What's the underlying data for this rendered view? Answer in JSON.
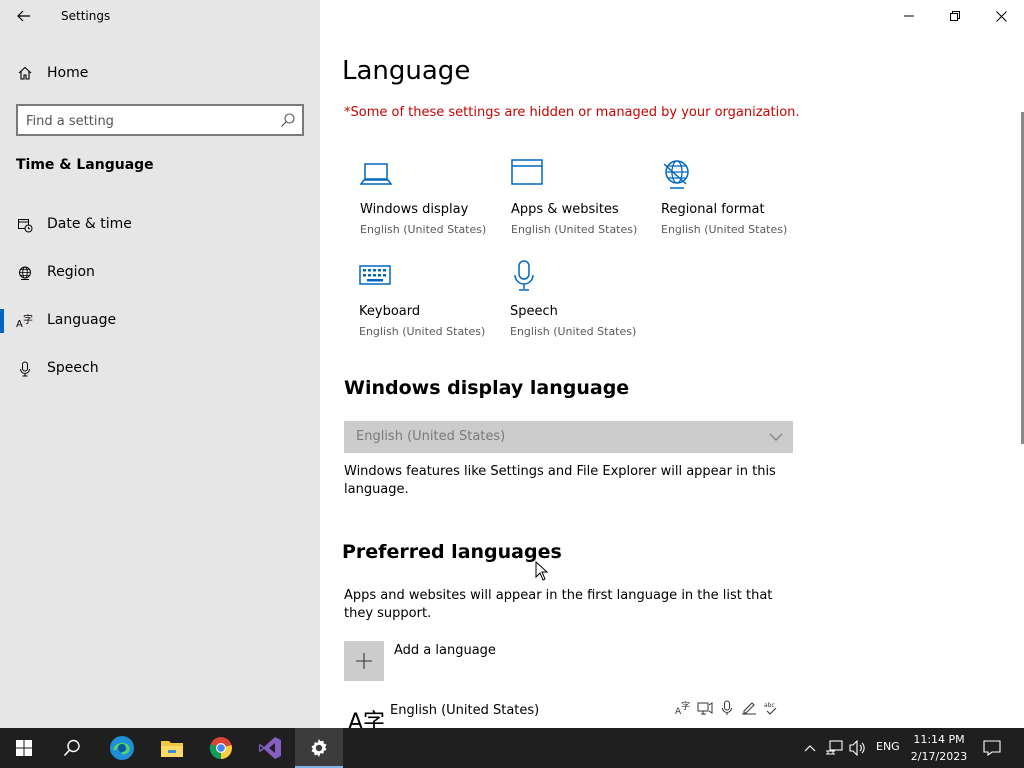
{
  "app": {
    "title": "Settings"
  },
  "sidebar": {
    "home_label": "Home",
    "search_placeholder": "Find a setting",
    "section_title": "Time & Language",
    "items": [
      {
        "label": "Date & time",
        "icon": "calendar-clock-icon"
      },
      {
        "label": "Region",
        "icon": "globe-icon"
      },
      {
        "label": "Language",
        "icon": "language-icon",
        "active": true
      },
      {
        "label": "Speech",
        "icon": "microphone-icon"
      }
    ]
  },
  "main": {
    "title": "Language",
    "org_notice": "*Some of these settings are hidden or managed by your organization.",
    "tiles": [
      {
        "name": "Windows display",
        "sub": "English (United States)",
        "icon": "laptop-icon"
      },
      {
        "name": "Apps & websites",
        "sub": "English (United States)",
        "icon": "window-icon"
      },
      {
        "name": "Regional format",
        "sub": "English (United States)",
        "icon": "globe-icon"
      },
      {
        "name": "Keyboard",
        "sub": "English (United States)",
        "icon": "keyboard-icon"
      },
      {
        "name": "Speech",
        "sub": "English (United States)",
        "icon": "microphone-icon"
      }
    ],
    "display_language": {
      "heading": "Windows display language",
      "selected": "English (United States)",
      "description": "Windows features like Settings and File Explorer will appear in this language."
    },
    "preferred": {
      "heading": "Preferred languages",
      "description": "Apps and websites will appear in the first language in the list that they support.",
      "add_label": "Add a language",
      "languages": [
        {
          "name": "English (United States)",
          "glyph": "A字"
        }
      ]
    }
  },
  "taskbar": {
    "apps": [
      "start-icon",
      "search-icon",
      "edge-icon",
      "file-explorer-icon",
      "chrome-icon",
      "visual-studio-icon",
      "settings-icon"
    ],
    "input_language": "ENG",
    "time": "11:14 PM",
    "date": "2/17/2023"
  },
  "colors": {
    "accent": "#0067c0",
    "notice": "#c50500",
    "sidebar_bg": "#e6e6e6",
    "taskbar_bg": "#1f1f1f"
  }
}
